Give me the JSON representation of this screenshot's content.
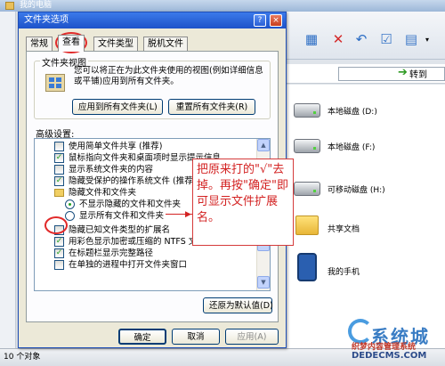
{
  "background_window": {
    "title": "我的电脑",
    "goto_label": "转到",
    "drives": [
      {
        "label": "本地磁盘 (D:)"
      },
      {
        "label": "本地磁盘 (F:)"
      },
      {
        "label": "可移动磁盘 (H:)"
      },
      {
        "label": "共享文档"
      },
      {
        "label": "我的手机"
      }
    ],
    "status": "10 个对象"
  },
  "watermark": {
    "big": "系统城",
    "line1": "织梦内容管理系统",
    "line2": "DEDECMS.COM"
  },
  "dialog": {
    "title": "文件夹选项",
    "help_btn": "?",
    "close_btn": "×",
    "tabs": [
      {
        "label": "常规"
      },
      {
        "label": "查看"
      },
      {
        "label": "文件类型"
      },
      {
        "label": "脱机文件"
      }
    ],
    "folder_view": {
      "title": "文件夹视图",
      "description": "您可以将正在为此文件夹使用的视图(例如详细信息或平铺)应用到所有文件夹。",
      "apply_all": "应用到所有文件夹(L)",
      "reset_all": "重置所有文件夹(R)"
    },
    "advanced_label": "高级设置:",
    "tree_items": [
      {
        "label": "使用简单文件共享 (推荐)",
        "kind": "checkbox",
        "checked": false
      },
      {
        "label": "鼠标指向文件夹和桌面项时显示提示信息",
        "kind": "checkbox",
        "checked": true
      },
      {
        "label": "显示系统文件夹的内容",
        "kind": "checkbox",
        "checked": false
      },
      {
        "label": "隐藏受保护的操作系统文件 (推荐)",
        "kind": "checkbox",
        "checked": true
      },
      {
        "label": "隐藏文件和文件夹",
        "kind": "folder",
        "checked": false
      },
      {
        "label": "不显示隐藏的文件和文件夹",
        "kind": "radio",
        "checked": true
      },
      {
        "label": "显示所有文件和文件夹",
        "kind": "radio",
        "checked": false
      },
      {
        "label": "隐藏已知文件类型的扩展名",
        "kind": "checkbox",
        "checked": false
      },
      {
        "label": "用彩色显示加密或压缩的 NTFS 文件",
        "kind": "checkbox",
        "checked": true
      },
      {
        "label": "在标题栏显示完整路径",
        "kind": "checkbox",
        "checked": true
      },
      {
        "label": "在单独的进程中打开文件夹窗口",
        "kind": "checkbox",
        "checked": false
      }
    ],
    "restore_defaults": "还原为默认值(D)",
    "ok": "确定",
    "cancel": "取消",
    "apply": "应用(A)"
  },
  "annotation": {
    "note": "把原来打的\"√\"去掉。再按\"确定\"即可显示文件扩展名。"
  },
  "check_mark": "✓"
}
